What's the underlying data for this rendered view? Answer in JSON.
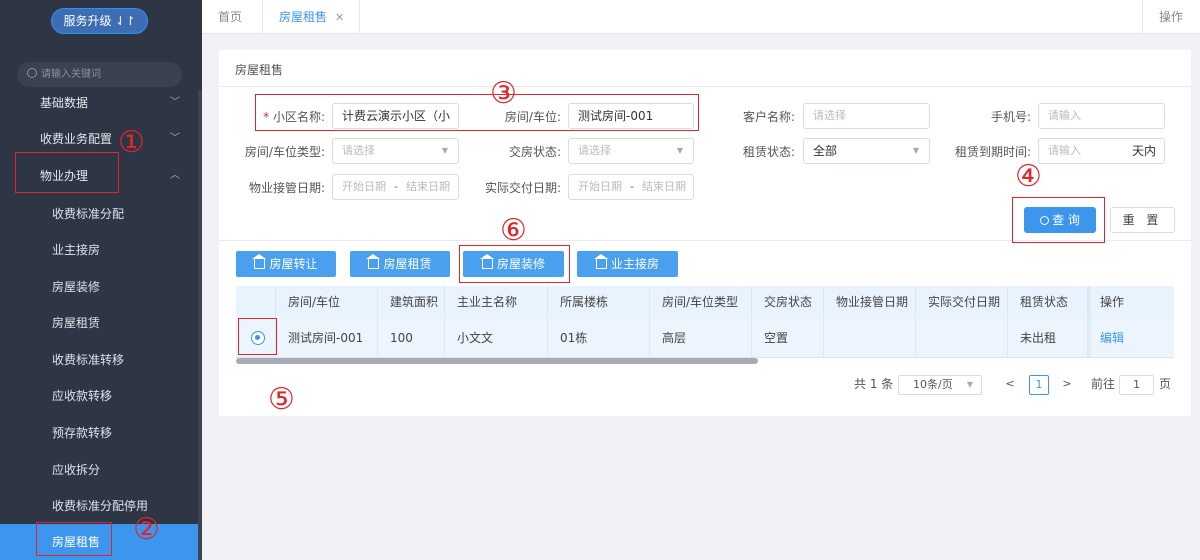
{
  "sidebar": {
    "upgrade_label": "服务升级 ⇃↾",
    "search_placeholder": "请输入关键词",
    "items": [
      {
        "label": "基础数据"
      },
      {
        "label": "收费业务配置"
      },
      {
        "label": "物业办理"
      }
    ],
    "sub_items": [
      {
        "label": "收费标准分配"
      },
      {
        "label": "业主接房"
      },
      {
        "label": "房屋装修"
      },
      {
        "label": "房屋租赁"
      },
      {
        "label": "收费标准转移"
      },
      {
        "label": "应收款转移"
      },
      {
        "label": "预存款转移"
      },
      {
        "label": "应收拆分"
      },
      {
        "label": "收费标准分配停用"
      },
      {
        "label": "房屋租售"
      }
    ]
  },
  "topbar": {
    "home_tab": "首页",
    "active_tab": "房屋租售",
    "ops_label": "操作"
  },
  "card": {
    "title": "房屋租售"
  },
  "form": {
    "community_label": "小区名称:",
    "community_value": "计费云演示小区（小",
    "room_label": "房间/车位:",
    "room_value": "测试房间-001",
    "customer_label": "客户名称:",
    "customer_placeholder": "请选择",
    "phone_label": "手机号:",
    "phone_placeholder": "请输入",
    "room_type_label": "房间/车位类型:",
    "room_type_placeholder": "请选择",
    "delivery_label": "交房状态:",
    "delivery_placeholder": "请选择",
    "rent_status_label": "租赁状态:",
    "rent_status_value": "全部",
    "expire_label": "租赁到期时间:",
    "expire_placeholder": "请输入",
    "expire_suffix": "天内",
    "takeover_label": "物业接管日期:",
    "actual_label": "实际交付日期:",
    "start_placeholder": "开始日期",
    "end_placeholder": "结束日期",
    "range_sep": "-",
    "query_label": "查 询",
    "reset_label": "重 置"
  },
  "actions": {
    "transfer": "房屋转让",
    "lease": "房屋租赁",
    "decorate": "房屋装修",
    "handover": "业主接房"
  },
  "table": {
    "headers": [
      "房间/车位",
      "建筑面积",
      "主业主名称",
      "所属楼栋",
      "房间/车位类型",
      "交房状态",
      "物业接管日期",
      "实际交付日期",
      "租赁状态",
      "操作"
    ],
    "rows": [
      {
        "room": "测试房间-001",
        "area": "100",
        "owner": "小文文",
        "building": "01栋",
        "room_type": "高层",
        "delivery": "空置",
        "takeover": "",
        "actual": "",
        "rent_status": "未出租",
        "action": "编辑"
      }
    ]
  },
  "pager": {
    "total": "共 1 条",
    "page_size": "10条/页",
    "prev": "<",
    "current": "1",
    "next": ">",
    "goto_label": "前往",
    "goto_value": "1",
    "page_suffix": "页"
  },
  "annotations": [
    "①",
    "②",
    "③",
    "④",
    "⑤",
    "⑥"
  ],
  "colors": {
    "accent": "#3c96ee",
    "sidebar_bg": "#2e3645",
    "annotation_red": "#e0262a"
  }
}
